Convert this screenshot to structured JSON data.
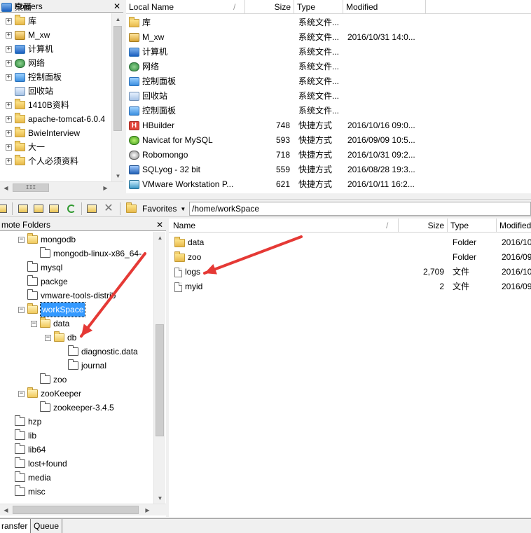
{
  "local_folders": {
    "title": "cal Folders",
    "items": [
      {
        "label": "桌面",
        "icon": "desktop-icon"
      },
      {
        "label": "库",
        "icon": "library-folder-icon"
      },
      {
        "label": "M_xw",
        "icon": "user-folder-icon"
      },
      {
        "label": "计算机",
        "icon": "computer-icon"
      },
      {
        "label": "网络",
        "icon": "network-icon"
      },
      {
        "label": "控制面板",
        "icon": "control-panel-icon"
      },
      {
        "label": "回收站",
        "icon": "recycle-bin-icon"
      },
      {
        "label": "1410B资料",
        "icon": "folder-icon"
      },
      {
        "label": "apache-tomcat-6.0.4",
        "icon": "folder-icon"
      },
      {
        "label": "BwieInterview",
        "icon": "folder-icon"
      },
      {
        "label": "大一",
        "icon": "folder-icon"
      },
      {
        "label": "个人必须资料",
        "icon": "folder-icon"
      }
    ],
    "scroll_thumb_glyph": "III"
  },
  "local_list": {
    "columns": {
      "name": "Local Name",
      "sort": "/",
      "size": "Size",
      "type": "Type",
      "modified": "Modified"
    },
    "rows": [
      {
        "name": "库",
        "size": "",
        "type": "系统文件...",
        "modified": "",
        "icon": "library-folder-icon"
      },
      {
        "name": "M_xw",
        "size": "",
        "type": "系统文件...",
        "modified": "2016/10/31 14:0...",
        "icon": "user-folder-icon"
      },
      {
        "name": "计算机",
        "size": "",
        "type": "系统文件...",
        "modified": "",
        "icon": "computer-icon"
      },
      {
        "name": "网络",
        "size": "",
        "type": "系统文件...",
        "modified": "",
        "icon": "network-icon"
      },
      {
        "name": "控制面板",
        "size": "",
        "type": "系统文件...",
        "modified": "",
        "icon": "control-panel-icon"
      },
      {
        "name": "回收站",
        "size": "",
        "type": "系统文件...",
        "modified": "",
        "icon": "recycle-bin-icon"
      },
      {
        "name": "控制面板",
        "size": "",
        "type": "系统文件...",
        "modified": "",
        "icon": "control-panel-icon"
      },
      {
        "name": "HBuilder",
        "size": "748",
        "type": "快捷方式",
        "modified": "2016/10/16 09:0...",
        "icon": "hbuilder-icon"
      },
      {
        "name": "Navicat for MySQL",
        "size": "593",
        "type": "快捷方式",
        "modified": "2016/09/09 10:5...",
        "icon": "navicat-icon"
      },
      {
        "name": "Robomongo",
        "size": "718",
        "type": "快捷方式",
        "modified": "2016/10/31 09:2...",
        "icon": "robomongo-icon"
      },
      {
        "name": "SQLyog - 32 bit",
        "size": "559",
        "type": "快捷方式",
        "modified": "2016/08/28 19:3...",
        "icon": "sqlyog-icon"
      },
      {
        "name": "VMware Workstation P...",
        "size": "621",
        "type": "快捷方式",
        "modified": "2016/10/11 16:2...",
        "icon": "vmware-icon"
      }
    ],
    "hbuilder_glyph": "H"
  },
  "toolbar": {
    "favorites_label": "Favorites",
    "path": "/home/workSpace"
  },
  "remote_folders": {
    "title": "mote Folders",
    "items": [
      {
        "label": "mongodb",
        "level": 2,
        "expanded": true
      },
      {
        "label": "mongodb-linux-x86_64-",
        "level": 3,
        "expanded": null
      },
      {
        "label": "mysql",
        "level": 2,
        "expanded": null
      },
      {
        "label": "packge",
        "level": 2,
        "expanded": null
      },
      {
        "label": "vmware-tools-distrib",
        "level": 2,
        "expanded": null
      },
      {
        "label": "workSpace",
        "level": 2,
        "expanded": true,
        "selected": true
      },
      {
        "label": "data",
        "level": 3,
        "expanded": true
      },
      {
        "label": "db",
        "level": 4,
        "expanded": true
      },
      {
        "label": "diagnostic.data",
        "level": 5,
        "expanded": null
      },
      {
        "label": "journal",
        "level": 5,
        "expanded": null
      },
      {
        "label": "zoo",
        "level": 3,
        "expanded": null
      },
      {
        "label": "zooKeeper",
        "level": 2,
        "expanded": true
      },
      {
        "label": "zookeeper-3.4.5",
        "level": 3,
        "expanded": null
      },
      {
        "label": "hzp",
        "level": 1,
        "expanded": null
      },
      {
        "label": "lib",
        "level": 1,
        "expanded": null
      },
      {
        "label": "lib64",
        "level": 1,
        "expanded": null
      },
      {
        "label": "lost+found",
        "level": 1,
        "expanded": null
      },
      {
        "label": "media",
        "level": 1,
        "expanded": null
      },
      {
        "label": "misc",
        "level": 1,
        "expanded": null
      }
    ]
  },
  "remote_list": {
    "columns": {
      "name": "Name",
      "sort": "/",
      "size": "Size",
      "type": "Type",
      "modified": "Modified"
    },
    "rows": [
      {
        "name": "data",
        "size": "",
        "type": "Folder",
        "modified": "2016/10",
        "icon": "folder-icon"
      },
      {
        "name": "zoo",
        "size": "",
        "type": "Folder",
        "modified": "2016/09",
        "icon": "folder-icon"
      },
      {
        "name": "logs",
        "size": "2,709",
        "type": "文件",
        "modified": "2016/10",
        "icon": "file-icon"
      },
      {
        "name": "myid",
        "size": "2",
        "type": "文件",
        "modified": "2016/09",
        "icon": "file-icon"
      }
    ]
  },
  "bottom_tabs": [
    {
      "label": "ransfer"
    },
    {
      "label": "Queue"
    }
  ],
  "annotation": {
    "color": "#e53935"
  }
}
